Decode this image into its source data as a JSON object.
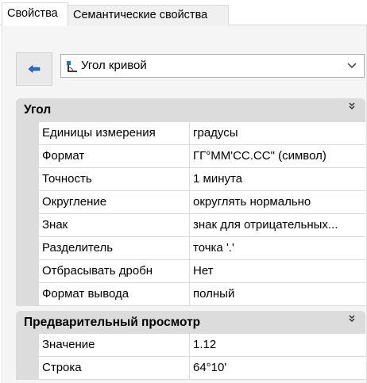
{
  "tabs": [
    {
      "label": "Свойства",
      "active": true
    },
    {
      "label": "Семантические свойства",
      "active": false
    }
  ],
  "toolbar": {
    "back_icon": "blue-left-arrow-icon",
    "combo_icon": "curve-angle-icon",
    "combo_value": "Угол кривой",
    "combo_arrow_icon": "chevron-down-icon"
  },
  "sections": [
    {
      "title": "Угол",
      "collapse_icon": "double-chevron-up-icon",
      "rows": [
        {
          "name": "Единицы измерения",
          "value": "градусы"
        },
        {
          "name": "Формат",
          "value": "ГГ°ММ'СС.СС\" (символ)"
        },
        {
          "name": "Точность",
          "value": "1 минута"
        },
        {
          "name": "Округление",
          "value": "округлять нормально"
        },
        {
          "name": "Знак",
          "value": "знак для отрицательных..."
        },
        {
          "name": "Разделитель",
          "value": "точка '.'"
        },
        {
          "name": "Отбрасывать дробн",
          "value": "Нет"
        },
        {
          "name": "Формат вывода",
          "value": "полный"
        }
      ]
    },
    {
      "title": "Предварительный просмотр",
      "collapse_icon": "double-chevron-up-icon",
      "rows": [
        {
          "name": "Значение",
          "value": "1.12"
        },
        {
          "name": "Строка",
          "value": "64°10'"
        }
      ]
    }
  ],
  "colors": {
    "section_header_bg": "#dcdcdc",
    "panel_bg": "#f5f5f5",
    "accent_blue": "#1f6fd1"
  }
}
